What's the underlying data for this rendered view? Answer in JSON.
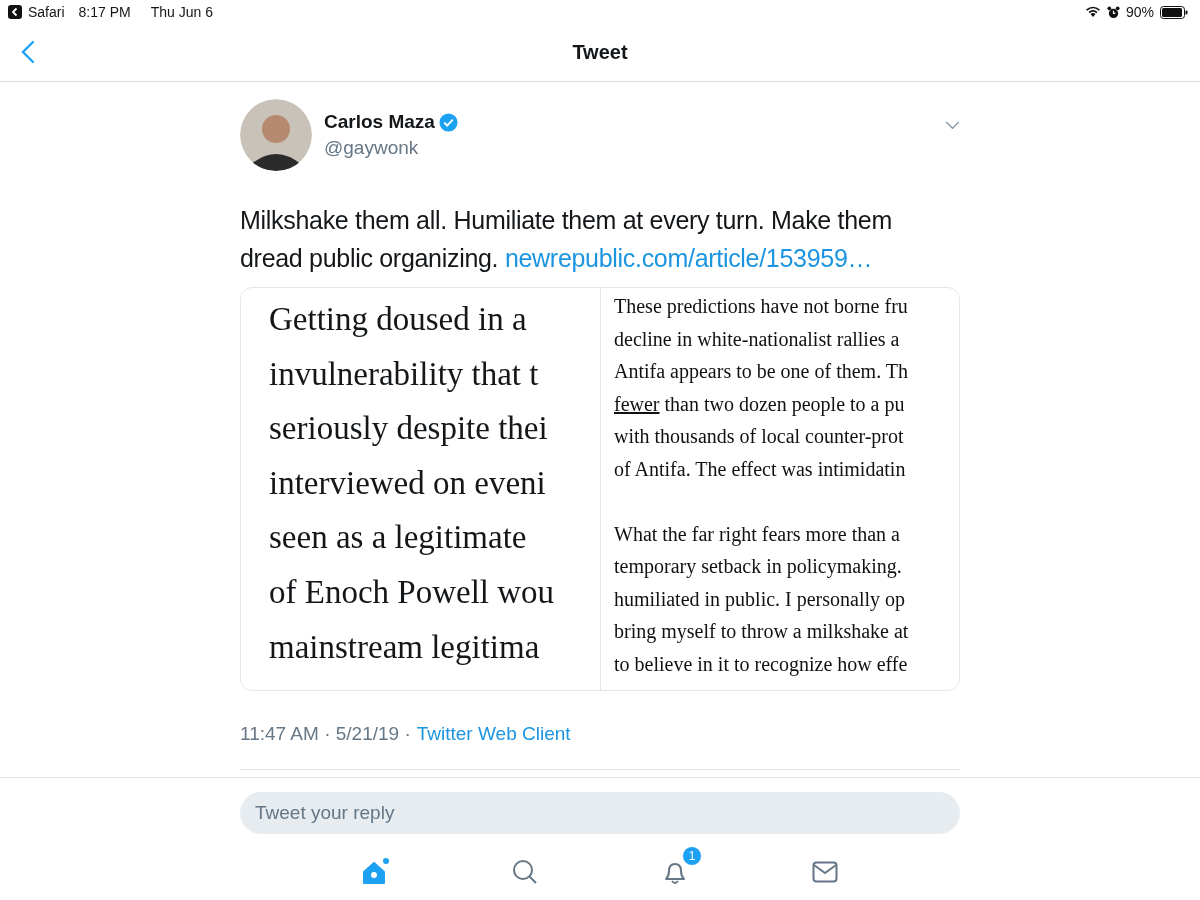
{
  "status_bar": {
    "back_app": "Safari",
    "time": "8:17 PM",
    "date": "Thu Jun 6",
    "battery": "90%"
  },
  "nav": {
    "title": "Tweet"
  },
  "tweet": {
    "name": "Carlos Maza",
    "verified": true,
    "handle": "@gaywonk",
    "text": "Milkshake them all. Humiliate them at every turn. Make them dread public organizing.",
    "link": "newrepublic.com/article/153959…",
    "media": {
      "left_lines": [
        "Getting doused in a",
        "invulnerability that t",
        "seriously despite thei",
        "interviewed on eveni",
        "seen as a legitimate",
        "of Enoch Powell wou",
        "mainstream legitima"
      ],
      "right_paragraphs": [
        [
          {
            "text": "These predictions have not borne fru"
          },
          {
            "text": "decline in white-nationalist rallies a"
          },
          {
            "text": "Antifa appears to be one of them. Th"
          },
          {
            "link": "fewer",
            "text": " than two dozen people to a pu"
          },
          {
            "text": "with thousands of local counter-prot"
          },
          {
            "text": "of Antifa. The effect was intimidatin"
          }
        ],
        [
          {
            "text": "What the far right fears more than a"
          },
          {
            "text": "temporary setback in policymaking."
          },
          {
            "text": "humiliated in public. I personally op"
          },
          {
            "text": "bring myself to throw a milkshake at"
          },
          {
            "text": "to believe in it to recognize how effe"
          }
        ]
      ]
    },
    "time": "11:47 AM · 5/21/19 ·",
    "source": "Twitter Web Client"
  },
  "reply": {
    "placeholder": "Tweet your reply"
  },
  "tab_bar": [
    {
      "kind": "home",
      "selected": true
    },
    {
      "kind": "search",
      "selected": false
    },
    {
      "kind": "notifications",
      "selected": false,
      "badge": "1"
    },
    {
      "kind": "messages",
      "selected": false
    }
  ]
}
